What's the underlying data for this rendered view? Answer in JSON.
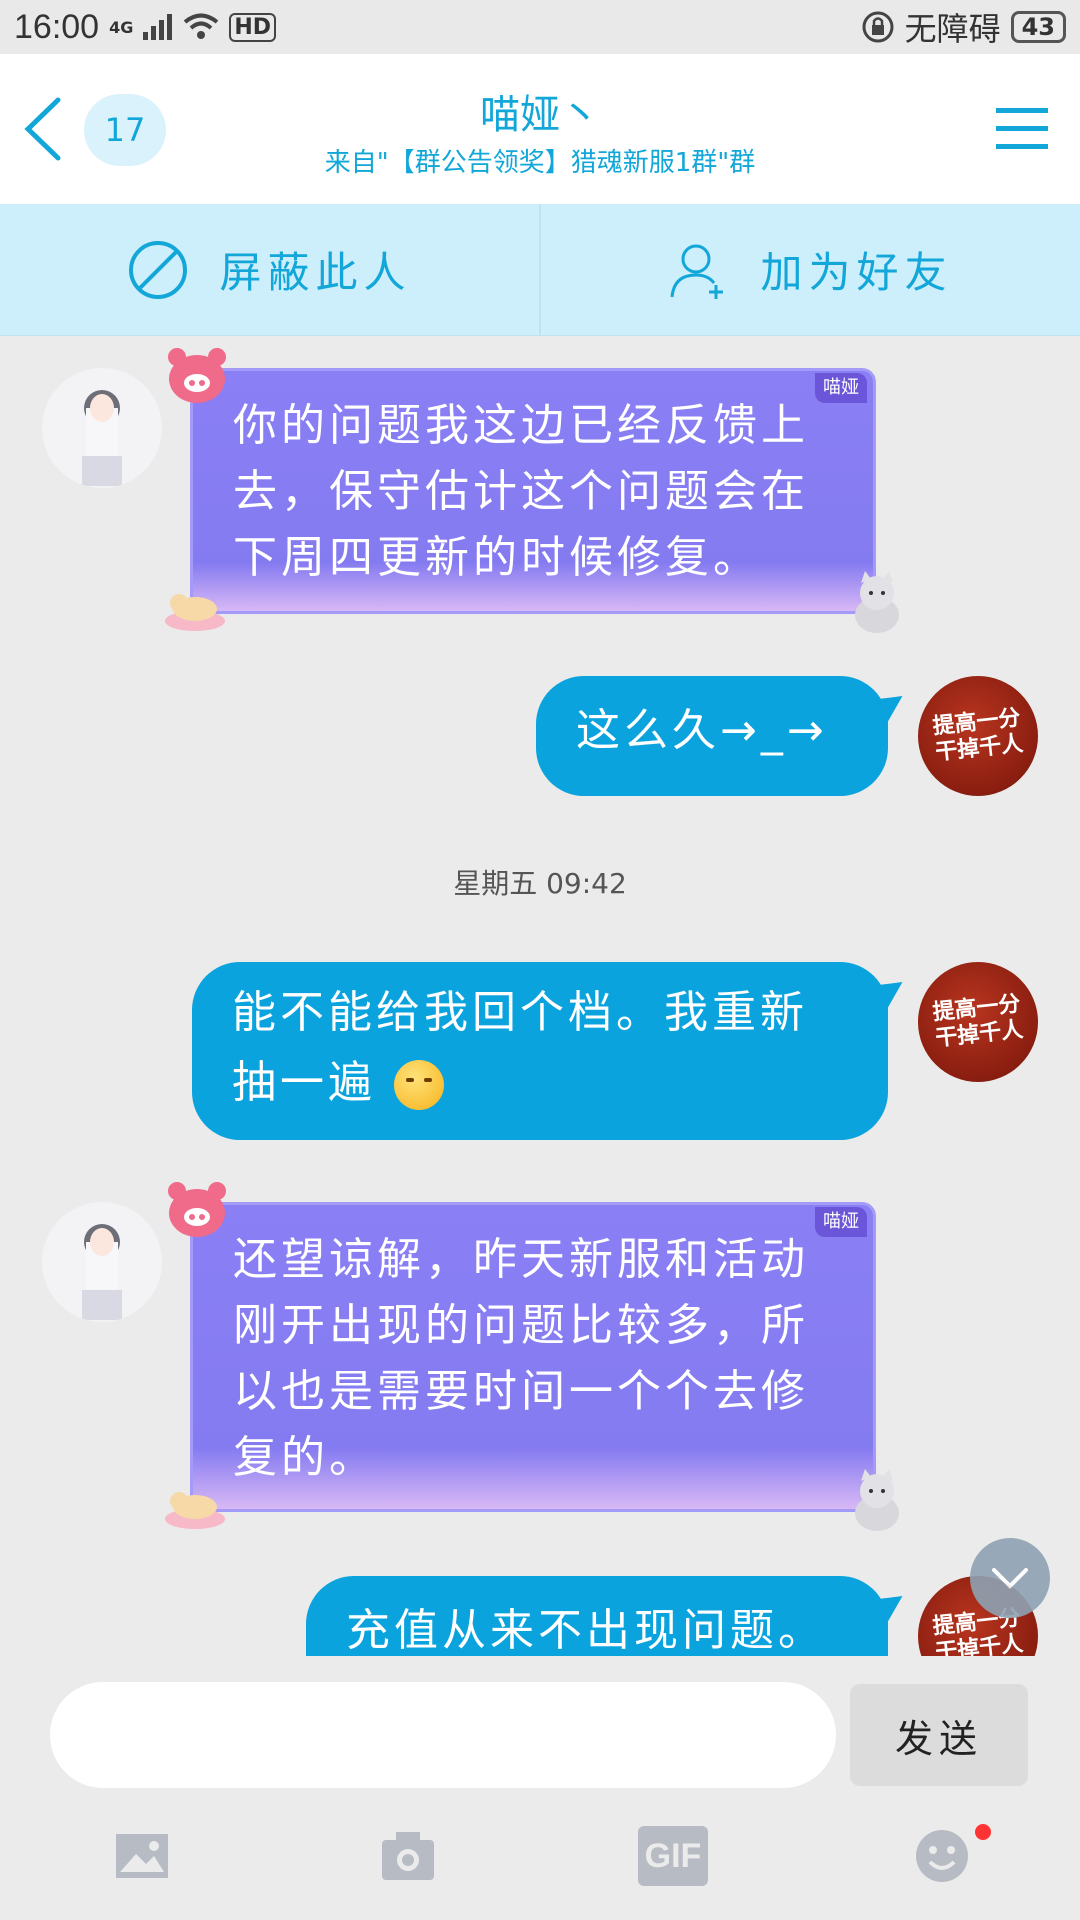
{
  "status_bar": {
    "time": "16:00",
    "network": "4G",
    "hd_badge": "HD",
    "accessibility": "无障碍",
    "battery": "43"
  },
  "header": {
    "unread_count": "17",
    "title": "喵娅丶",
    "subtitle": "来自\"【群公告领奖】猎魂新服1群\"群"
  },
  "actions": {
    "block_label": "屏蔽此人",
    "add_friend_label": "加为好友"
  },
  "messages": [
    {
      "side": "left",
      "sender_tag": "喵娅",
      "text": "你的问题我这边已经反馈上去，保守估计这个问题会在下周四更新的时候修复。"
    },
    {
      "side": "right",
      "text": "这么久→_→"
    },
    {
      "side": "center",
      "timestamp": "星期五 09:42"
    },
    {
      "side": "right",
      "text": "能不能给我回个档。我重新抽一遍"
    },
    {
      "side": "left",
      "sender_tag": "喵娅",
      "text": "还望谅解，昨天新服和活动刚开出现的问题比较多，所以也是需要时间一个个去修复的。"
    },
    {
      "side": "right",
      "text": "充值从来不出现问题。"
    }
  ],
  "avatar_text": {
    "red": "提高一分\n干掉千人"
  },
  "input": {
    "placeholder": "",
    "send_label": "发送"
  },
  "toolbar": {
    "gif_label": "GIF"
  },
  "colors": {
    "accent": "#12a7d8",
    "bubble_blue": "#0aa3de",
    "bubble_purple": "#8a7ff4"
  }
}
